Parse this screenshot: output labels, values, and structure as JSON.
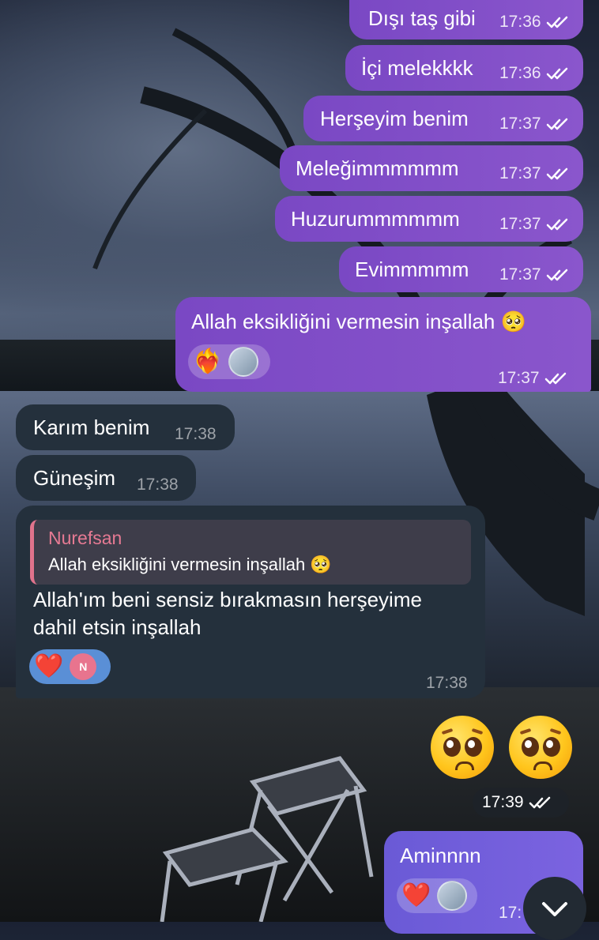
{
  "messages": [
    {
      "text": "Dışı taş gibi",
      "time": "17:36"
    },
    {
      "text": "İçi melekkkk",
      "time": "17:36"
    },
    {
      "text": "Herşeyim benim",
      "time": "17:37"
    },
    {
      "text": "Meleğimmmmmm",
      "time": "17:37"
    },
    {
      "text": "Huzurummmmmm",
      "time": "17:37"
    },
    {
      "text": "Evimmmmm",
      "time": "17:37"
    },
    {
      "text": "Allah eksikliğini vermesin inşallah 🥺",
      "time": "17:37"
    },
    {
      "text": "Karım benim",
      "time": "17:38"
    },
    {
      "text": "Güneşim",
      "time": "17:38"
    },
    {
      "reply_name": "Nurefsan",
      "reply_text": "Allah eksikliğini vermesin inşallah 🥺",
      "text_line1": "Allah'ım beni sensiz bırakmasın herşeyime",
      "text_line2": "dahil etsin inşallah",
      "time": "17:38",
      "reaction_avatar_letter": "N"
    },
    {
      "emoji": "🥺 🥺",
      "time": "17:39"
    },
    {
      "text": "Aminnnn",
      "time": "17:"
    }
  ],
  "icons": {
    "read": "double-check-icon",
    "scroll_down": "chevron-down-icon",
    "heart_fire": "heart-on-fire-icon",
    "heart": "red-heart-icon"
  },
  "colors": {
    "outgoing": "#7c4ec0",
    "outgoing_last": "#6a5ad6",
    "incoming": "#24303c",
    "reply_accent": "#e0738c"
  }
}
